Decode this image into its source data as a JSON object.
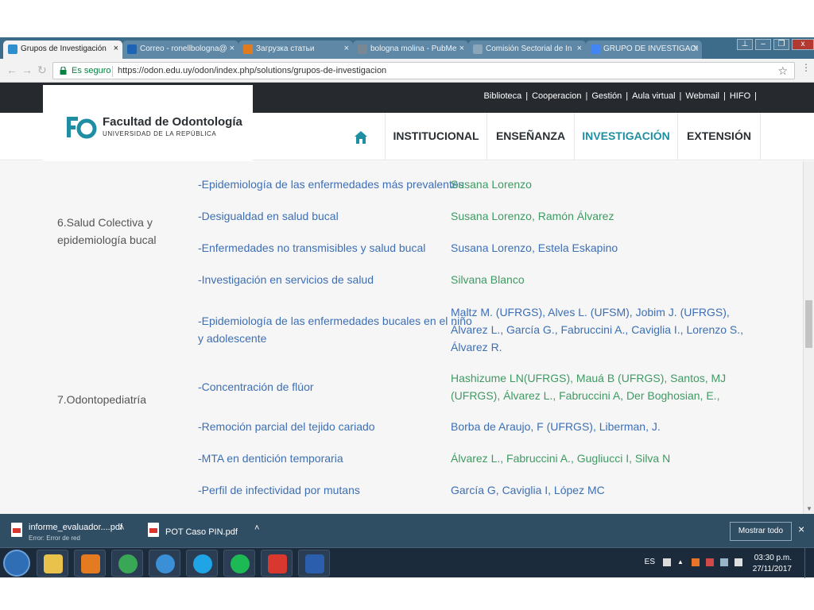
{
  "browser": {
    "tabs": [
      {
        "title": "Grupos de Investigación",
        "active": true,
        "icon": "fo-favicon"
      },
      {
        "title": "Correo - ronellbologna@",
        "active": false,
        "icon": "outlook-icon"
      },
      {
        "title": "Загрузка статьи",
        "active": false,
        "icon": "eye-icon"
      },
      {
        "title": "bologna molina - PubMe",
        "active": false,
        "icon": "pubmed-icon"
      },
      {
        "title": "Comisión Sectorial de In",
        "active": false,
        "icon": "blank-page-icon"
      },
      {
        "title": "GRUPO DE INVESTIGACI",
        "active": false,
        "icon": "google-icon"
      }
    ],
    "tab_close_glyph": "×",
    "window_buttons": [
      "⊥",
      "–",
      "❐",
      "x"
    ],
    "secure_label": "Es seguro",
    "url": "https://odon.edu.uy/odon/index.php/solutions/grupos-de-investigacion",
    "star_glyph": "☆",
    "menu_glyph": "⋮"
  },
  "site": {
    "top_links": [
      "Biblioteca",
      "Cooperacion",
      "Gestión",
      "Aula virtual",
      "Webmail",
      "HIFO"
    ],
    "logo": {
      "title": "Facultad de Odontología",
      "subtitle": "UNIVERSIDAD DE LA REPÚBLICA"
    },
    "nav": [
      {
        "label": "INSTITUCIONAL",
        "active": false
      },
      {
        "label": "ENSEÑANZA",
        "active": false
      },
      {
        "label": "INVESTIGACIÓN",
        "active": true
      },
      {
        "label": "EXTENSIÓN",
        "active": false
      }
    ],
    "accent_color": "#1f8ea3"
  },
  "groups": [
    {
      "name_lines": [
        "6.Salud Colectiva y",
        "epidemiología bucal"
      ],
      "rows": [
        {
          "line": [
            "-Epidemiología de las enfermedades más prevalentes"
          ],
          "people": [
            "Susana Lorenzo"
          ],
          "people_color": "green"
        },
        {
          "line": [
            "-Desigualdad en salud bucal"
          ],
          "people": [
            "Susana Lorenzo, Ramón Álvarez"
          ],
          "people_color": "green"
        },
        {
          "line": [
            "-Enfermedades no transmisibles y salud bucal"
          ],
          "people": [
            "Susana Lorenzo, Estela Eskapino"
          ],
          "people_color": "blue"
        },
        {
          "line": [
            "-Investigación en servicios de salud"
          ],
          "people": [
            "Silvana Blanco"
          ],
          "people_color": "green"
        }
      ]
    },
    {
      "name_lines": [
        "7.Odontopediatría"
      ],
      "rows": [
        {
          "line": [
            "-Epidemiología de las enfermedades bucales en el niño",
            "y adolescente"
          ],
          "people": [
            "Maltz M. (UFRGS), Alves L. (UFSM), Jobim J. (UFRGS),",
            "Álvarez L., García G., Fabruccini A., Caviglia I., Lorenzo S.,",
            "Álvarez R."
          ],
          "people_color": "blue"
        },
        {
          "line": [
            "-Concentración de flúor"
          ],
          "people": [
            "Hashizume  LN(UFRGS), Mauá B (UFRGS), Santos, MJ",
            "(UFRGS), Álvarez L., Fabruccini A, Der Boghosian, E.,"
          ],
          "people_color": "green"
        },
        {
          "line": [
            "-Remoción parcial del tejido cariado"
          ],
          "people": [
            "Borba de Araujo, F (UFRGS), Liberman, J."
          ],
          "people_color": "blue"
        },
        {
          "line": [
            "-MTA en dentición temporaria"
          ],
          "people": [
            "Álvarez L., Fabruccini A., Gugliucci I, Silva N"
          ],
          "people_color": "green"
        },
        {
          "line": [
            "-Perfil de infectividad por mutans"
          ],
          "people": [
            "García G, Caviglia I, López MC"
          ],
          "people_color": "blue"
        }
      ]
    }
  ],
  "downloads": [
    {
      "name": "informe_evaluador....pdf",
      "status": "Error: Error de red"
    },
    {
      "name": "POT Caso PIN.pdf",
      "status": ""
    }
  ],
  "downloads_show_all": "Mostrar todo",
  "downloads_close": "×",
  "taskbar": {
    "apps": [
      "file-explorer-icon",
      "media-player-icon",
      "chrome-icon",
      "internet-explorer-icon",
      "skype-icon",
      "spotify-icon",
      "acrobat-icon",
      "word-icon"
    ],
    "language": "ES",
    "time": "03:30 p.m.",
    "date": "27/11/2017"
  }
}
